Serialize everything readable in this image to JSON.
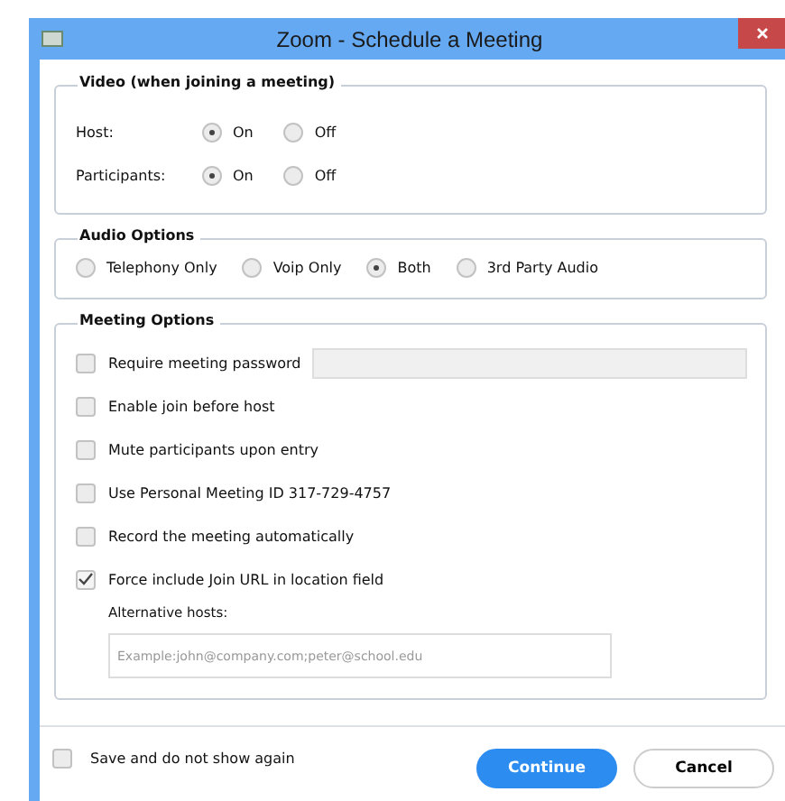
{
  "window": {
    "title": "Zoom - Schedule a Meeting"
  },
  "video": {
    "legend": "Video (when joining a meeting)",
    "rows": [
      {
        "label": "Host:",
        "options": [
          {
            "label": "On",
            "selected": true
          },
          {
            "label": "Off",
            "selected": false
          }
        ]
      },
      {
        "label": "Participants:",
        "options": [
          {
            "label": "On",
            "selected": true
          },
          {
            "label": "Off",
            "selected": false
          }
        ]
      }
    ]
  },
  "audio": {
    "legend": "Audio Options",
    "options": [
      {
        "label": "Telephony Only",
        "selected": false
      },
      {
        "label": "Voip Only",
        "selected": false
      },
      {
        "label": "Both",
        "selected": true
      },
      {
        "label": "3rd Party Audio",
        "selected": false
      }
    ]
  },
  "meeting": {
    "legend": "Meeting Options",
    "options": [
      {
        "label": "Require meeting password",
        "checked": false,
        "kind": "password"
      },
      {
        "label": "Enable join before host",
        "checked": false,
        "kind": "plain"
      },
      {
        "label": "Mute participants upon entry",
        "checked": false,
        "kind": "plain"
      },
      {
        "label": "Use Personal Meeting ID 317-729-4757",
        "checked": false,
        "kind": "plain"
      },
      {
        "label": "Record the meeting automatically",
        "checked": false,
        "kind": "plain"
      },
      {
        "label": "Force include Join URL in location field",
        "checked": true,
        "kind": "plain"
      }
    ],
    "password_field": {
      "disabled": true
    },
    "alt_hosts": {
      "label": "Alternative hosts:",
      "placeholder": "Example:john@company.com;peter@school.edu"
    }
  },
  "footer": {
    "save": {
      "label": "Save and do not show again",
      "checked": false
    },
    "buttons": [
      {
        "label": "Continue",
        "kind": "primary"
      },
      {
        "label": "Cancel",
        "kind": "secondary"
      }
    ]
  }
}
